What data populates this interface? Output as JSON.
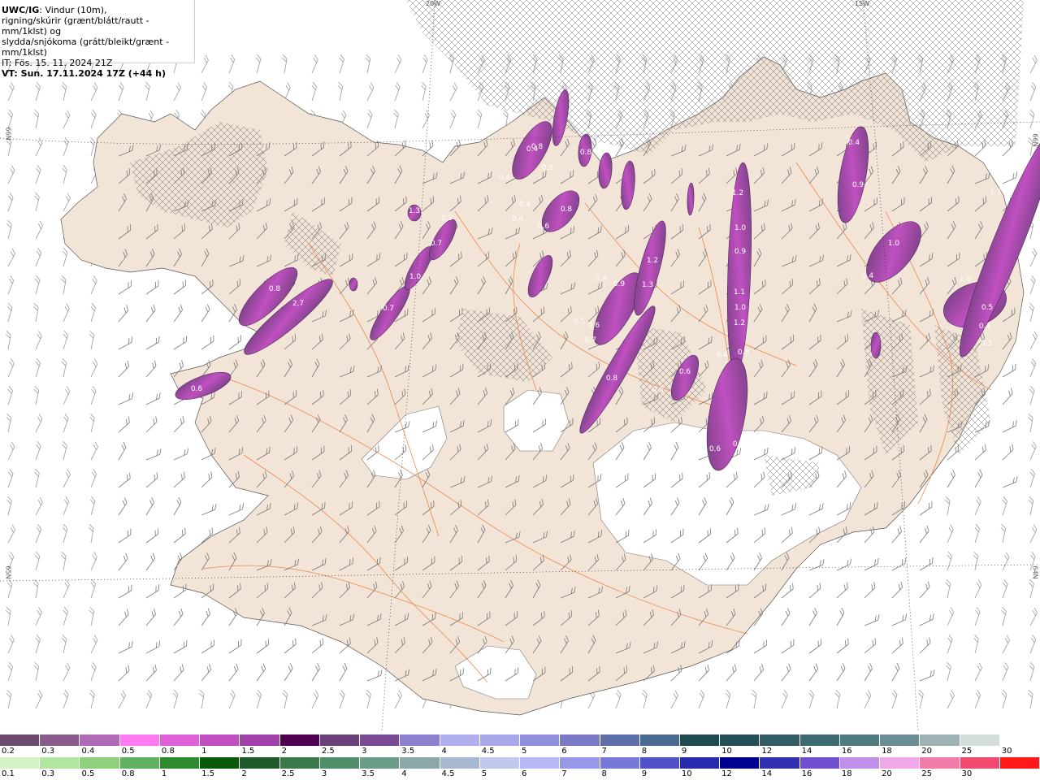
{
  "header": {
    "model": "UWC/IG",
    "line1_rest": ": Vindur (10m),",
    "line2": "rigning/skúrir (grænt/blátt/rautt - mm/1klst) og",
    "line3": "slydda/snjókoma (grátt/bleikt/grænt - mm/1klst)",
    "line4": "IT: Fös. 15. 11. 2024 21Z",
    "line5": "VT: Sun. 17.11.2024 17Z (+44 h)"
  },
  "grid_labels": {
    "top_20w": "20W",
    "top_15w": "15W",
    "left_66n": "66N",
    "left_65n": "65N",
    "right_66n": "66N",
    "right_64n": "64N"
  },
  "cell_labels": [
    "0.8",
    "2.7",
    "0.6",
    "1.3",
    "0.7",
    "0.5",
    "0.7",
    "1.0",
    "0.4",
    "0.4",
    "0.8",
    "0.4",
    "0.8",
    "0.8",
    "0.6",
    "0.4",
    "0.8",
    "0.4",
    "0.9",
    "0.5",
    "0.6",
    "0.7",
    "1.2",
    "1.3",
    "0.8",
    "0.6",
    "0.5",
    "1.2",
    "1.0",
    "0.9",
    "1.1",
    "1.0",
    "1.2",
    "0.8",
    "0.4",
    "0.6",
    "0.4",
    "0.3",
    "0.4",
    "0.9",
    "1.0",
    "0.4",
    "1.0",
    "0.5",
    "0.4",
    "0.3",
    "1.3"
  ],
  "legend": {
    "snow": {
      "colors": [
        "#6b4a6e",
        "#8a5c8e",
        "#b06bb8",
        "#ff7cf0",
        "#e060d8",
        "#c050c0",
        "#a040a8",
        "#500050",
        "#6b3f7a",
        "#7a4a95",
        "#8f7fcf",
        "#b0b0ee",
        "#a8a8e8",
        "#9090dd",
        "#7a7ac8",
        "#5e6ea8",
        "#4a6a90",
        "#1e4a50",
        "#244e58",
        "#335c66",
        "#3e6a72",
        "#4e7a80",
        "#6a8e94",
        "#9eb2b4",
        "#d4dcdc",
        "#ffffff"
      ],
      "labels": [
        "0.2",
        "0.3",
        "0.4",
        "0.5",
        "0.8",
        "1",
        "1.5",
        "2",
        "2.5",
        "3",
        "3.5",
        "4",
        "4.5",
        "5",
        "6",
        "7",
        "8",
        "9",
        "10",
        "12",
        "14",
        "16",
        "18",
        "20",
        "25",
        "30"
      ]
    },
    "rain": {
      "colors": [
        "#d4f4c8",
        "#b0e6a0",
        "#8ed07e",
        "#60b060",
        "#2e8a2e",
        "#0a5a0a",
        "#1e5a2a",
        "#3a7a4a",
        "#4e8e68",
        "#6a9e88",
        "#8aa8a8",
        "#a8b8d0",
        "#c0c8ee",
        "#b8b8f4",
        "#9898e8",
        "#7878d8",
        "#5050c8",
        "#2a2ab0",
        "#000090",
        "#3030b0",
        "#7050d0",
        "#c090e8",
        "#f0a8e8",
        "#f07aa8",
        "#f04a70",
        "#ff1a1a"
      ],
      "labels": [
        "0.1",
        "0.3",
        "0.5",
        "0.8",
        "1",
        "1.5",
        "2",
        "2.5",
        "3",
        "3.5",
        "4",
        "4.5",
        "5",
        "6",
        "7",
        "8",
        "9",
        "10",
        "12",
        "14",
        "16",
        "18",
        "20",
        "25",
        "30"
      ]
    }
  }
}
